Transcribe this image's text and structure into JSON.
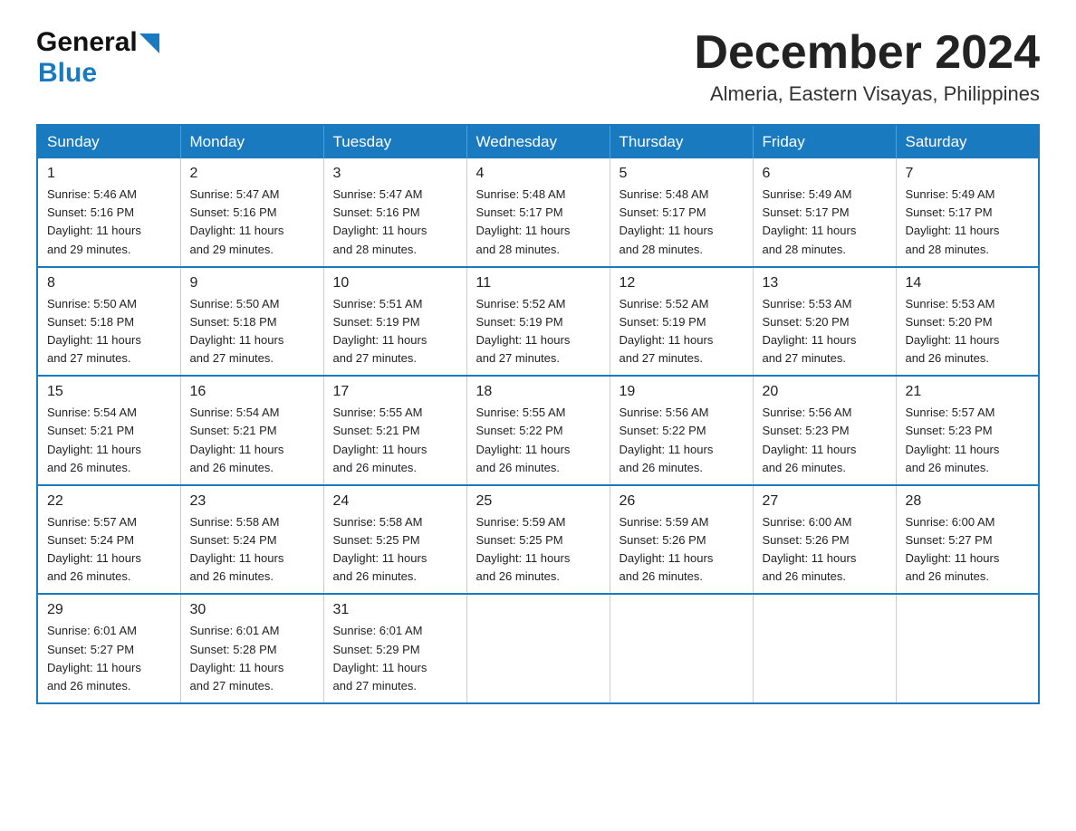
{
  "header": {
    "logo_general": "General",
    "logo_blue": "Blue",
    "month_year": "December 2024",
    "location": "Almeria, Eastern Visayas, Philippines"
  },
  "days_of_week": [
    "Sunday",
    "Monday",
    "Tuesday",
    "Wednesday",
    "Thursday",
    "Friday",
    "Saturday"
  ],
  "weeks": [
    [
      {
        "day": "1",
        "sunrise": "5:46 AM",
        "sunset": "5:16 PM",
        "daylight": "11 hours and 29 minutes."
      },
      {
        "day": "2",
        "sunrise": "5:47 AM",
        "sunset": "5:16 PM",
        "daylight": "11 hours and 29 minutes."
      },
      {
        "day": "3",
        "sunrise": "5:47 AM",
        "sunset": "5:16 PM",
        "daylight": "11 hours and 28 minutes."
      },
      {
        "day": "4",
        "sunrise": "5:48 AM",
        "sunset": "5:17 PM",
        "daylight": "11 hours and 28 minutes."
      },
      {
        "day": "5",
        "sunrise": "5:48 AM",
        "sunset": "5:17 PM",
        "daylight": "11 hours and 28 minutes."
      },
      {
        "day": "6",
        "sunrise": "5:49 AM",
        "sunset": "5:17 PM",
        "daylight": "11 hours and 28 minutes."
      },
      {
        "day": "7",
        "sunrise": "5:49 AM",
        "sunset": "5:17 PM",
        "daylight": "11 hours and 28 minutes."
      }
    ],
    [
      {
        "day": "8",
        "sunrise": "5:50 AM",
        "sunset": "5:18 PM",
        "daylight": "11 hours and 27 minutes."
      },
      {
        "day": "9",
        "sunrise": "5:50 AM",
        "sunset": "5:18 PM",
        "daylight": "11 hours and 27 minutes."
      },
      {
        "day": "10",
        "sunrise": "5:51 AM",
        "sunset": "5:19 PM",
        "daylight": "11 hours and 27 minutes."
      },
      {
        "day": "11",
        "sunrise": "5:52 AM",
        "sunset": "5:19 PM",
        "daylight": "11 hours and 27 minutes."
      },
      {
        "day": "12",
        "sunrise": "5:52 AM",
        "sunset": "5:19 PM",
        "daylight": "11 hours and 27 minutes."
      },
      {
        "day": "13",
        "sunrise": "5:53 AM",
        "sunset": "5:20 PM",
        "daylight": "11 hours and 27 minutes."
      },
      {
        "day": "14",
        "sunrise": "5:53 AM",
        "sunset": "5:20 PM",
        "daylight": "11 hours and 26 minutes."
      }
    ],
    [
      {
        "day": "15",
        "sunrise": "5:54 AM",
        "sunset": "5:21 PM",
        "daylight": "11 hours and 26 minutes."
      },
      {
        "day": "16",
        "sunrise": "5:54 AM",
        "sunset": "5:21 PM",
        "daylight": "11 hours and 26 minutes."
      },
      {
        "day": "17",
        "sunrise": "5:55 AM",
        "sunset": "5:21 PM",
        "daylight": "11 hours and 26 minutes."
      },
      {
        "day": "18",
        "sunrise": "5:55 AM",
        "sunset": "5:22 PM",
        "daylight": "11 hours and 26 minutes."
      },
      {
        "day": "19",
        "sunrise": "5:56 AM",
        "sunset": "5:22 PM",
        "daylight": "11 hours and 26 minutes."
      },
      {
        "day": "20",
        "sunrise": "5:56 AM",
        "sunset": "5:23 PM",
        "daylight": "11 hours and 26 minutes."
      },
      {
        "day": "21",
        "sunrise": "5:57 AM",
        "sunset": "5:23 PM",
        "daylight": "11 hours and 26 minutes."
      }
    ],
    [
      {
        "day": "22",
        "sunrise": "5:57 AM",
        "sunset": "5:24 PM",
        "daylight": "11 hours and 26 minutes."
      },
      {
        "day": "23",
        "sunrise": "5:58 AM",
        "sunset": "5:24 PM",
        "daylight": "11 hours and 26 minutes."
      },
      {
        "day": "24",
        "sunrise": "5:58 AM",
        "sunset": "5:25 PM",
        "daylight": "11 hours and 26 minutes."
      },
      {
        "day": "25",
        "sunrise": "5:59 AM",
        "sunset": "5:25 PM",
        "daylight": "11 hours and 26 minutes."
      },
      {
        "day": "26",
        "sunrise": "5:59 AM",
        "sunset": "5:26 PM",
        "daylight": "11 hours and 26 minutes."
      },
      {
        "day": "27",
        "sunrise": "6:00 AM",
        "sunset": "5:26 PM",
        "daylight": "11 hours and 26 minutes."
      },
      {
        "day": "28",
        "sunrise": "6:00 AM",
        "sunset": "5:27 PM",
        "daylight": "11 hours and 26 minutes."
      }
    ],
    [
      {
        "day": "29",
        "sunrise": "6:01 AM",
        "sunset": "5:27 PM",
        "daylight": "11 hours and 26 minutes."
      },
      {
        "day": "30",
        "sunrise": "6:01 AM",
        "sunset": "5:28 PM",
        "daylight": "11 hours and 27 minutes."
      },
      {
        "day": "31",
        "sunrise": "6:01 AM",
        "sunset": "5:29 PM",
        "daylight": "11 hours and 27 minutes."
      },
      null,
      null,
      null,
      null
    ]
  ],
  "labels": {
    "sunrise": "Sunrise:",
    "sunset": "Sunset:",
    "daylight": "Daylight:"
  }
}
